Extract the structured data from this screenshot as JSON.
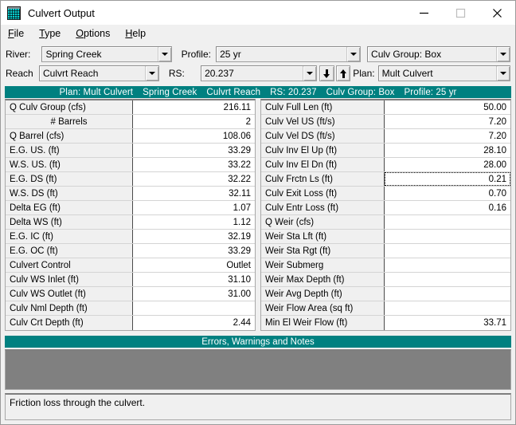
{
  "window": {
    "title": "Culvert Output",
    "icon": "grid-icon",
    "controls": {
      "minimize": "minimize-icon",
      "maximize": "maximize-icon",
      "close": "close-icon"
    }
  },
  "menubar": {
    "items": [
      {
        "mnemonic": "F",
        "rest": "ile"
      },
      {
        "mnemonic": "T",
        "rest": "ype"
      },
      {
        "mnemonic": "O",
        "rest": "ptions"
      },
      {
        "mnemonic": "H",
        "rest": "elp"
      }
    ]
  },
  "selectors": {
    "river_label": "River:",
    "river_value": "Spring Creek",
    "reach_label": "Reach",
    "reach_value": "Culvrt Reach",
    "profile_label": "Profile:",
    "profile_value": "25 yr",
    "rs_label": "RS:",
    "rs_value": "20.237",
    "culv_group_value": "Culv Group:  Box",
    "plan_label": "Plan:",
    "plan_value": "Mult Culvert",
    "prev_arrow": "arrow-down-icon",
    "next_arrow": "arrow-up-icon"
  },
  "banner": {
    "plan": "Plan: Mult Culvert",
    "river": "Spring Creek",
    "reach": "Culvrt Reach",
    "rs": "RS: 20.237",
    "culv_group": "Culv Group:  Box",
    "profile": "Profile: 25 yr"
  },
  "left_table": {
    "rows": [
      {
        "label": "Q Culv Group (cfs)",
        "value": "216.11"
      },
      {
        "label": "# Barrels",
        "value": "2"
      },
      {
        "label": "Q Barrel (cfs)",
        "value": "108.06"
      },
      {
        "label": "E.G. US. (ft)",
        "value": "33.29"
      },
      {
        "label": "W.S. US. (ft)",
        "value": "33.22"
      },
      {
        "label": "E.G. DS (ft)",
        "value": "32.22"
      },
      {
        "label": "W.S. DS (ft)",
        "value": "32.11"
      },
      {
        "label": "Delta EG (ft)",
        "value": "1.07"
      },
      {
        "label": "Delta WS (ft)",
        "value": "1.12"
      },
      {
        "label": "E.G. IC (ft)",
        "value": "32.19"
      },
      {
        "label": "E.G. OC (ft)",
        "value": "33.29"
      },
      {
        "label": "Culvert Control",
        "value": "Outlet"
      },
      {
        "label": "Culv WS Inlet (ft)",
        "value": "31.10"
      },
      {
        "label": "Culv WS Outlet (ft)",
        "value": "31.00"
      },
      {
        "label": "Culv Nml Depth (ft)",
        "value": ""
      },
      {
        "label": "Culv Crt Depth (ft)",
        "value": "2.44"
      }
    ]
  },
  "right_table": {
    "rows": [
      {
        "label": "Culv Full Len (ft)",
        "value": "50.00"
      },
      {
        "label": "Culv Vel US (ft/s)",
        "value": "7.20"
      },
      {
        "label": "Culv Vel DS (ft/s)",
        "value": "7.20"
      },
      {
        "label": "Culv Inv El Up (ft)",
        "value": "28.10"
      },
      {
        "label": "Culv Inv El Dn (ft)",
        "value": "28.00"
      },
      {
        "label": "Culv Frctn Ls (ft)",
        "value": "0.21",
        "focused": true
      },
      {
        "label": "Culv Exit Loss (ft)",
        "value": "0.70"
      },
      {
        "label": "Culv Entr Loss (ft)",
        "value": "0.16"
      },
      {
        "label": "Q Weir (cfs)",
        "value": ""
      },
      {
        "label": "Weir Sta Lft (ft)",
        "value": ""
      },
      {
        "label": "Weir Sta Rgt (ft)",
        "value": ""
      },
      {
        "label": "Weir Submerg",
        "value": ""
      },
      {
        "label": "Weir Max Depth (ft)",
        "value": ""
      },
      {
        "label": "Weir Avg Depth (ft)",
        "value": ""
      },
      {
        "label": "Weir Flow Area (sq ft)",
        "value": ""
      },
      {
        "label": "Min El Weir Flow (ft)",
        "value": "33.71"
      }
    ]
  },
  "errors": {
    "banner": "Errors, Warnings and Notes",
    "content": ""
  },
  "status": {
    "text": "Friction loss through the culvert."
  },
  "colors": {
    "teal": "#008080",
    "panel_gray": "#808080",
    "window_bg": "#f0f0f0"
  }
}
